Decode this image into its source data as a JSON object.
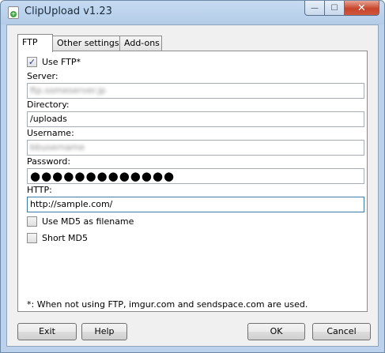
{
  "window": {
    "title": "ClipUpload v1.23",
    "controls": {
      "minimize": "—",
      "maximize": "☐",
      "close": "✕"
    }
  },
  "tabs": [
    {
      "label": "FTP",
      "active": true
    },
    {
      "label": "Other settings",
      "active": false
    },
    {
      "label": "Add-ons",
      "active": false
    }
  ],
  "ftp": {
    "use_ftp": {
      "label": "Use FTP*",
      "checked": true,
      "mark": "✓"
    },
    "server": {
      "label": "Server:",
      "value": "ftp.someserver.jp"
    },
    "directory": {
      "label": "Directory:",
      "value": "/uploads"
    },
    "username": {
      "label": "Username:",
      "value": "bbusername"
    },
    "password": {
      "label": "Password:",
      "value": "●●●●●●●●●●●●●"
    },
    "http": {
      "label": "HTTP:",
      "value": "http://sample.com/"
    },
    "use_md5": {
      "label": "Use MD5 as filename",
      "checked": false
    },
    "short_md5": {
      "label": "Short MD5",
      "checked": false
    },
    "note": "*: When not using FTP, imgur.com and sendspace.com are used."
  },
  "buttons": {
    "exit": "Exit",
    "help": "Help",
    "ok": "OK",
    "cancel": "Cancel"
  }
}
